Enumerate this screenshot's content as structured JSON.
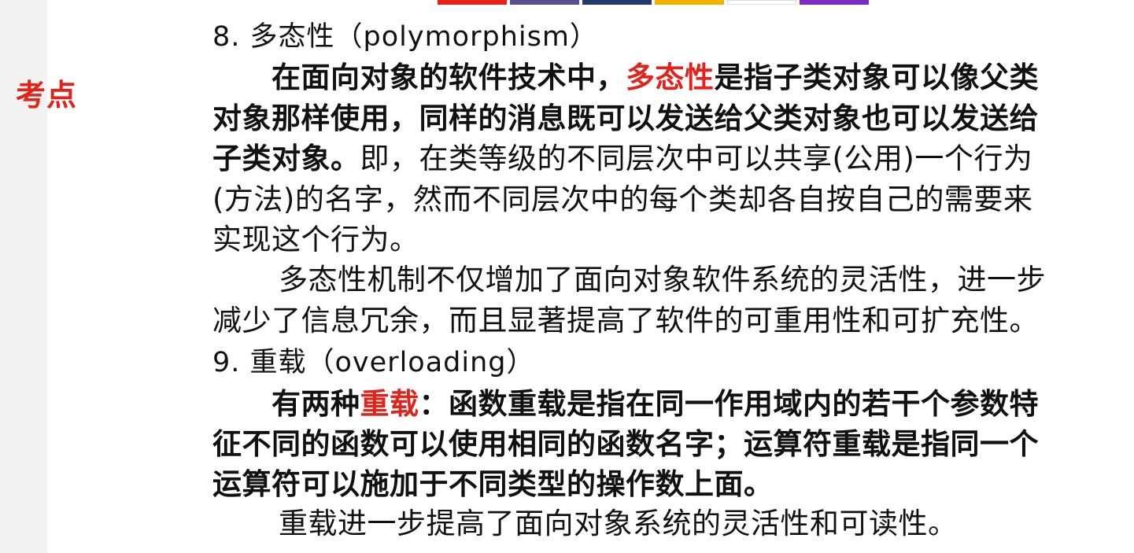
{
  "margin_label": "考点",
  "top_strip_colors": [
    "#e8231a",
    "#5a4f8c",
    "#1f3a6b",
    "#f0b400",
    "#ffffff",
    "#7b2cc4"
  ],
  "sections": [
    {
      "heading": "8. 多态性（polymorphism）",
      "definition": {
        "part1": "在面向对象的软件技术中，",
        "keyword": "多态性",
        "part2": "是指子类对象可以像父类",
        "line2": "对象那样使用，同样的消息既可以发送给父类对象也可以发送给",
        "line3_bold": "子类对象。",
        "line3_normal": "即，在类等级的不同层次中可以共享(公用)一个行为",
        "line4": "(方法)的名字，然而不同层次中的每个类却各自按自己的需要来",
        "line5": "实现这个行为。"
      },
      "note": {
        "line1": "多态性机制不仅增加了面向对象软件系统的灵活性，进一步",
        "line2": "减少了信息冗余，而且显著提高了软件的可重用性和可扩充性。"
      }
    },
    {
      "heading": "9. 重载（overloading）",
      "definition": {
        "part1": "有两种",
        "keyword": "重载",
        "part2": "：函数重载是指在同一作用域内的若干个参数特",
        "line2": "征不同的函数可以使用相同的函数名字；运算符重载是指同一个",
        "line3": "运算符可以施加于不同类型的操作数上面。"
      },
      "note": {
        "line1": "重载进一步提高了面向对象系统的灵活性和可读性。"
      }
    }
  ]
}
